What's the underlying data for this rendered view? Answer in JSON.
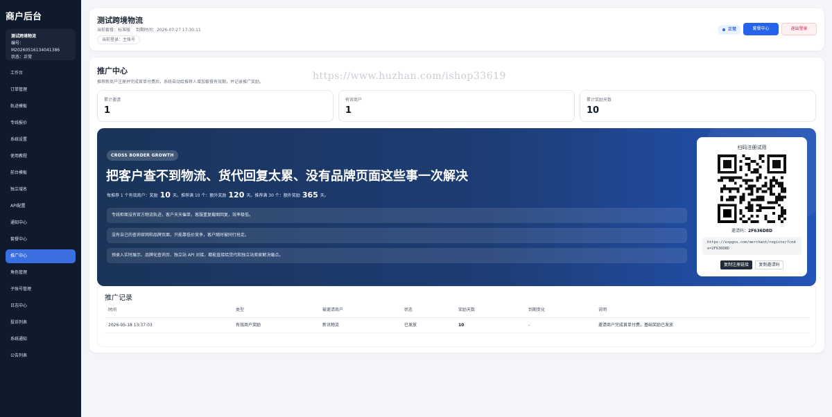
{
  "sidebar": {
    "brand": "商户后台",
    "account": {
      "name": "测试跨境物流",
      "id_line": "编号：M20260516134041386",
      "status_line": "状态：正常"
    },
    "items": [
      {
        "label": "工作台"
      },
      {
        "label": "订单管理"
      },
      {
        "label": "轨迹模板"
      },
      {
        "label": "专线报价"
      },
      {
        "label": "系统设置"
      },
      {
        "label": "使用教程"
      },
      {
        "label": "前台模板"
      },
      {
        "label": "独立域名"
      },
      {
        "label": "API配置"
      },
      {
        "label": "通知中心"
      },
      {
        "label": "套餐中心"
      },
      {
        "label": "推广中心"
      },
      {
        "label": "角色管理"
      },
      {
        "label": "子账号管理"
      },
      {
        "label": "日志中心"
      },
      {
        "label": "投诉列表"
      },
      {
        "label": "系统通知"
      },
      {
        "label": "公告列表"
      }
    ],
    "active_index": 11
  },
  "header": {
    "title": "测试跨境物流",
    "plan": "当前套餐：标准版",
    "expiry": "到期时间：2026-07-27 17:30:11",
    "login_chip": "当前登录：主账号",
    "status": "正常",
    "plan_button": "套餐中心",
    "logout_button": "退出登录"
  },
  "main": {
    "title": "推广中心",
    "desc": "推荐新商户注册并完成首单付费后，系统自动给推荐人增加套餐有效期，并记录推广奖励。",
    "watermark": "https://www.huzhan.com/ishop33619",
    "stats": [
      {
        "label": "累计邀请",
        "value": "1"
      },
      {
        "label": "有效商户",
        "value": "1"
      },
      {
        "label": "累计奖励天数",
        "value": "10"
      }
    ]
  },
  "banner": {
    "tag": "CROSS BORDER GROWTH",
    "headline": "把客户查不到物流、货代回复太累、没有品牌页面这些事一次解决",
    "reward": {
      "p1": "每推荐 1 个有效商户：奖励",
      "v1": "10",
      "p2": "天。推荐满 10 个：额外奖励",
      "v2": "120",
      "p3": "天。推荐满 30 个：额外奖励",
      "v3": "365",
      "p4": "天。"
    },
    "bullets": [
      "专线柜面没有官方物流轨迹，客户天天催单，客服重复截图回复，效率极低。",
      "没有自己的查询官网和品牌页面，只能靠低价竞争，客户随时被同行抢走。",
      "预录入实时展示、品牌化查询页、独立站 API 对接，都能直接给货代和独立站卖家解决痛点。"
    ]
  },
  "qr": {
    "title": "扫码注册试用",
    "code_label": "邀请码：",
    "code": "2F636D8D",
    "url": "https://expgos.com/merchant/register?code=2F636D8D",
    "copy_link": "复制注册链接",
    "copy_code": "复制邀请码"
  },
  "records": {
    "title": "推广记录",
    "columns": [
      "时间",
      "类型",
      "被邀请商户",
      "状态",
      "奖励天数",
      "到期变化",
      "说明"
    ],
    "rows": [
      [
        "2026-05-18 13:37:03",
        "有效商户奖励",
        "新讯物流",
        "已发放",
        "10",
        "-",
        "邀请商户完成首单付费，基础奖励已发放"
      ]
    ]
  }
}
